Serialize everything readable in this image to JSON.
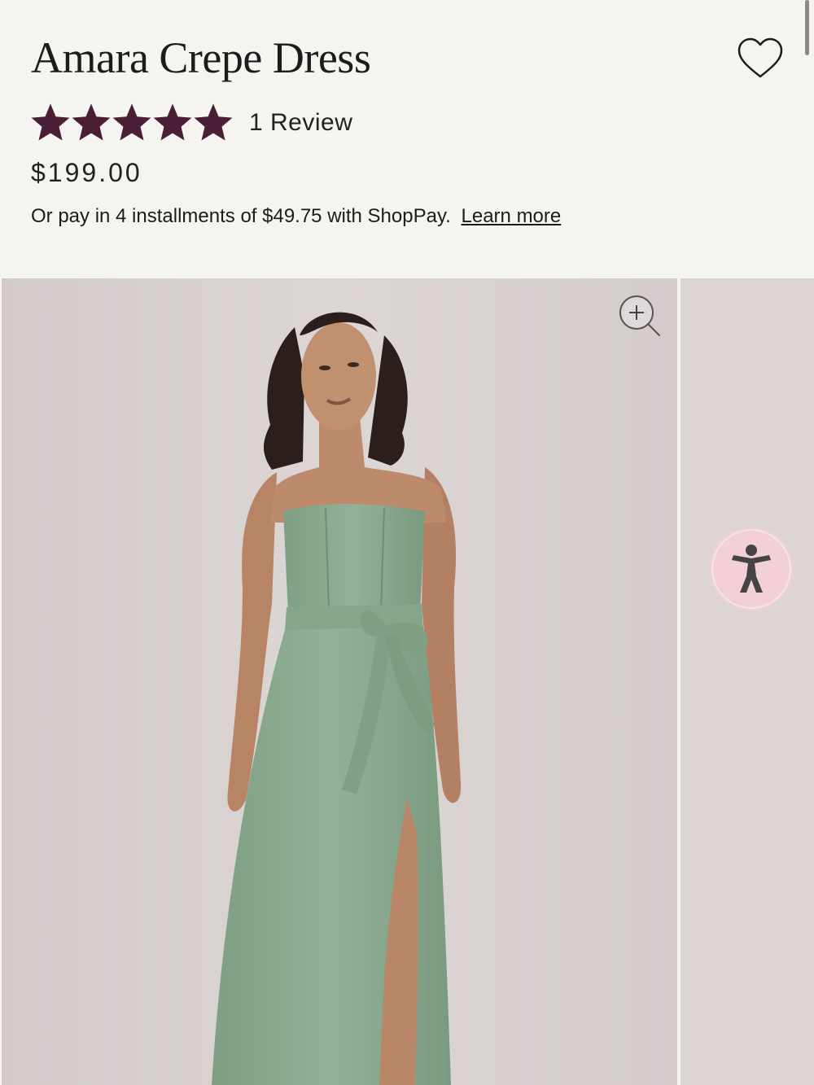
{
  "product": {
    "title": "Amara Crepe Dress",
    "rating": 5,
    "rating_max": 5,
    "review_label": "1 Review",
    "price": "$199.00",
    "installments_text": "Or pay in 4 installments of $49.75 with ShopPay.",
    "learn_more": "Learn more"
  },
  "icons": {
    "wishlist": "heart-outline-icon",
    "star": "star-icon",
    "zoom": "zoom-in-icon",
    "accessibility": "accessibility-person-icon"
  },
  "colors": {
    "star": "#4a1f35",
    "page_background": "#f6f4f1",
    "dress": "#8aaa8f",
    "accessibility_button": "#f3cfd8"
  },
  "gallery": {
    "current_image": "Model wearing sage green strapless crepe dress with tie waist and front slit"
  }
}
